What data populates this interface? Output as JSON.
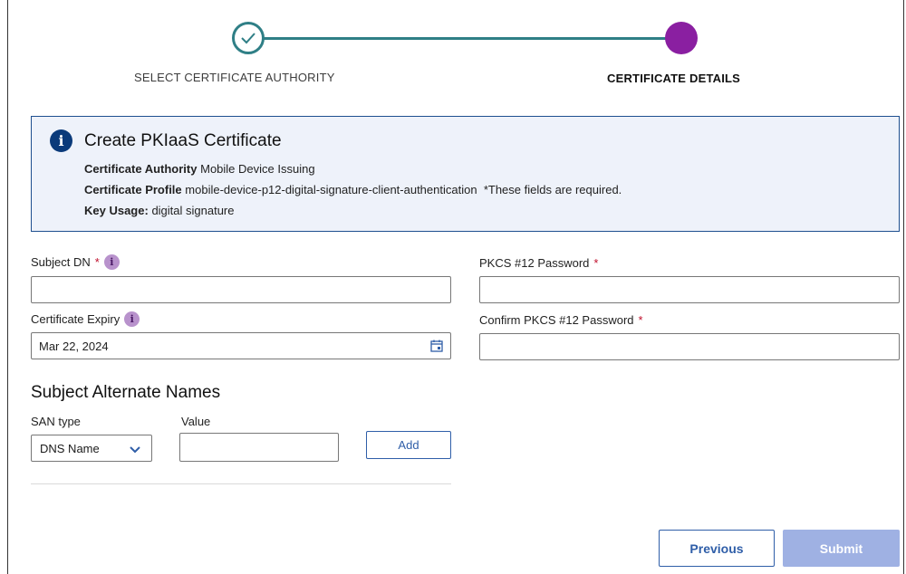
{
  "stepper": {
    "steps": [
      {
        "label": "SELECT CERTIFICATE AUTHORITY",
        "state": "complete"
      },
      {
        "label": "CERTIFICATE DETAILS",
        "state": "current"
      }
    ],
    "colors": {
      "complete": "#2f7f86",
      "current": "#8a1fa1"
    }
  },
  "info": {
    "icon": "info-icon",
    "title": "Create PKIaaS Certificate",
    "ca_key": "Certificate Authority",
    "ca_value": "Mobile Device Issuing",
    "profile_key": "Certificate Profile",
    "profile_value": "mobile-device-p12-digital-signature-client-authentication",
    "required_note": "*These fields are required.",
    "key_usage_key": "Key Usage:",
    "key_usage_value": "digital signature"
  },
  "form": {
    "subject_dn": {
      "label": "Subject DN",
      "required_mark": "*",
      "value": ""
    },
    "expiry": {
      "label": "Certificate Expiry",
      "value": "Mar 22, 2024"
    },
    "pkcs_password": {
      "label": "PKCS #12 Password",
      "required_mark": "*",
      "value": ""
    },
    "confirm_password": {
      "label": "Confirm PKCS #12 Password",
      "required_mark": "*",
      "value": ""
    }
  },
  "san": {
    "title": "Subject Alternate Names",
    "type_label": "SAN type",
    "value_label": "Value",
    "type_selected": "DNS Name",
    "value": "",
    "add_label": "Add"
  },
  "actions": {
    "previous_label": "Previous",
    "submit_label": "Submit"
  }
}
